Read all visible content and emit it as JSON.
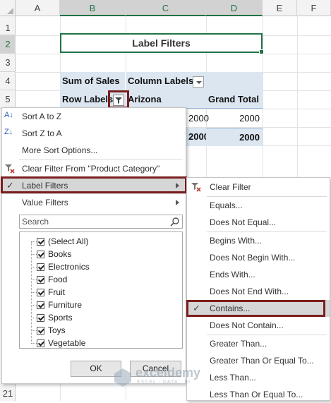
{
  "columns": [
    "A",
    "B",
    "C",
    "D",
    "E",
    "F"
  ],
  "rows": [
    "1",
    "2",
    "3",
    "4",
    "5",
    "21"
  ],
  "title": "Label Filters",
  "pivot": {
    "sum_of_sales": "Sum of Sales",
    "column_labels": "Column Labels",
    "row_labels": "Row Labels",
    "arizona": "Arizona",
    "grand_total": "Grand Total",
    "v1": "2000",
    "v2": "2000",
    "v3": "2000",
    "v4": "2000"
  },
  "menu": {
    "sort_az": "Sort A to Z",
    "sort_za": "Sort Z to A",
    "more_sort": "More Sort Options...",
    "clear_filter_from": "Clear Filter From \"Product Category\"",
    "label_filters": "Label Filters",
    "value_filters": "Value Filters",
    "search_placeholder": "Search",
    "items": [
      "(Select All)",
      "Books",
      "Electronics",
      "Food",
      "Fruit",
      "Furniture",
      "Sports",
      "Toys",
      "Vegetable"
    ],
    "ok": "OK",
    "cancel": "Cancel"
  },
  "submenu": {
    "items": [
      "Clear Filter",
      "Equals...",
      "Does Not Equal...",
      "Begins With...",
      "Does Not Begin With...",
      "Ends With...",
      "Does Not End With...",
      "Contains...",
      "Does Not Contain...",
      "Greater Than...",
      "Greater Than Or Equal To...",
      "Less Than...",
      "Less Than Or Equal To..."
    ]
  },
  "watermark": {
    "name": "exceldemy",
    "tagline": "EXCEL · DATA · BI"
  },
  "colors": {
    "excel_green": "#217346",
    "pivot_header": "#dce6f1",
    "highlight_border": "#7b1e1e"
  }
}
